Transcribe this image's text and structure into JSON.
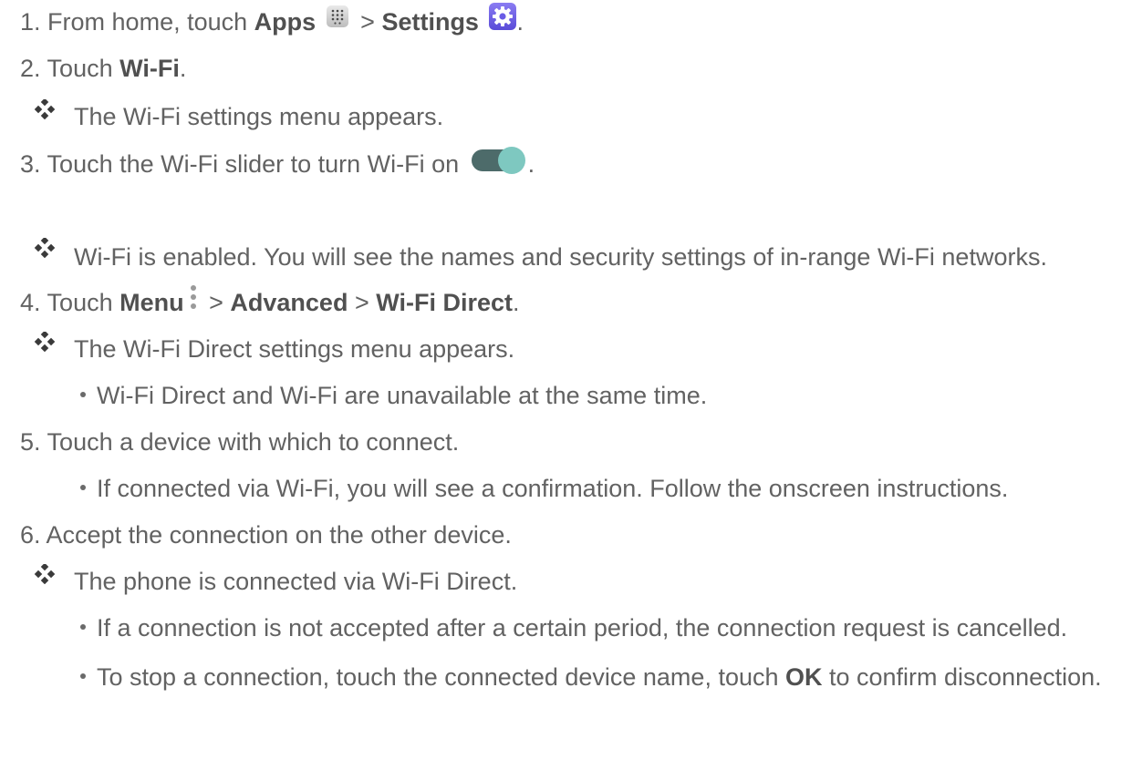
{
  "steps": [
    {
      "num": "1.",
      "pre": "From home, touch ",
      "apps": "Apps",
      "sep": " > ",
      "settings": "Settings",
      "post": "."
    },
    {
      "num": "2.",
      "pre": "Touch ",
      "bold": "Wi-Fi",
      "post": "."
    },
    {
      "num": "3.",
      "pre": "Touch the Wi-Fi slider to turn Wi-Fi on ",
      "post": "."
    },
    {
      "num": "4.",
      "pre": "Touch ",
      "menu": "Menu",
      "sep1": " > ",
      "advanced": "Advanced",
      "sep2": " > ",
      "direct": "Wi-Fi Direct",
      "post": "."
    },
    {
      "num": "5.",
      "text": "Touch a device with which to connect."
    },
    {
      "num": "6.",
      "text": "Accept the connection on the other device."
    }
  ],
  "results": [
    "The Wi-Fi settings menu appears.",
    "Wi-Fi is enabled. You will see the names and security settings of in-range Wi-Fi networks.",
    "The Wi-Fi Direct settings menu appears.",
    "The phone is connected via Wi-Fi Direct."
  ],
  "bullets": [
    "Wi-Fi Direct and Wi-Fi are unavailable at the same time.",
    "If connected via Wi-Fi, you will see a confirmation. Follow the onscreen instructions.",
    "If a connection is not accepted after a certain period, the connection request is cancelled.",
    {
      "pre": "To stop a connection, touch the connected device name, touch ",
      "bold": "OK",
      "post": " to confirm disconnection."
    }
  ],
  "icons": {
    "apps": "apps-grid-icon",
    "settings": "settings-gear-icon",
    "toggle": "toggle-on-icon",
    "menu": "menu-dots-icon",
    "result": "diamond-bullet-icon",
    "bullet": "dot-bullet-icon"
  },
  "colors": {
    "text": "#626262",
    "bold": "#505050",
    "toggle_track": "#4d6b6a",
    "toggle_knob": "#7ec8c0",
    "settings_icon": "#6a5ce6"
  }
}
